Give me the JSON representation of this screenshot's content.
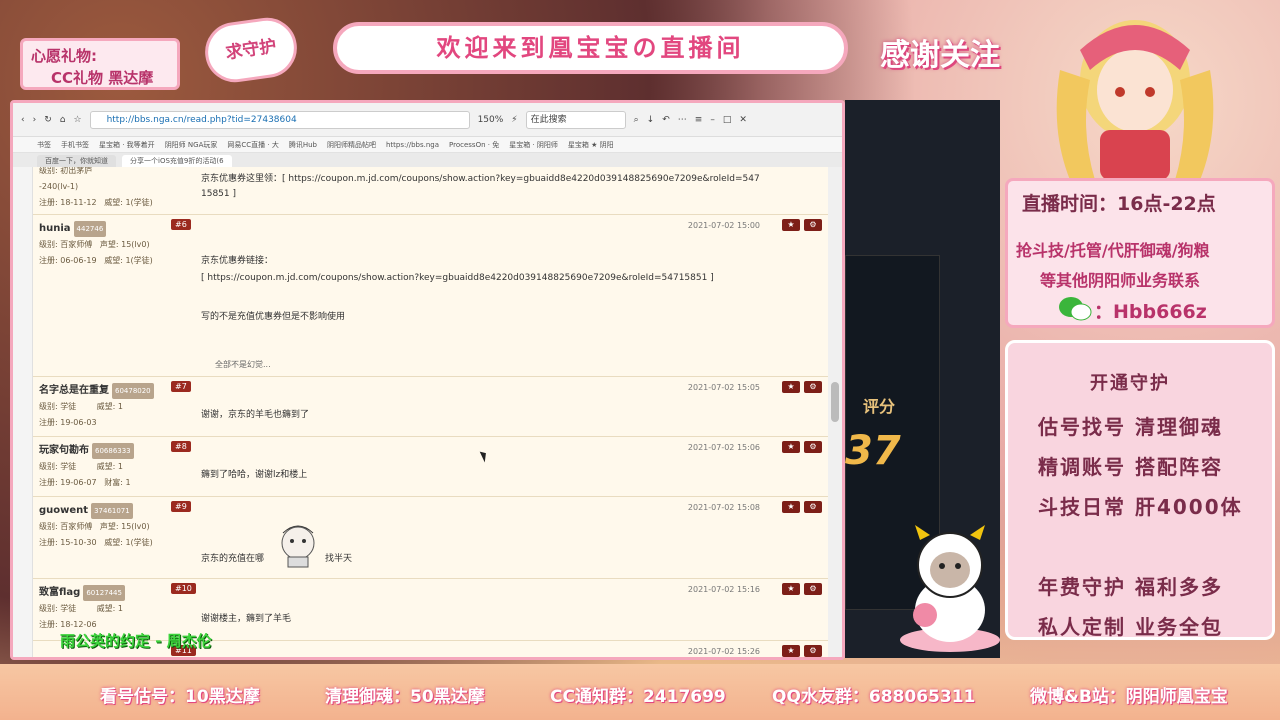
{
  "overlay": {
    "wish_title": "心愿礼物:",
    "wish_item": "CC礼物 黑达摩",
    "guard_badge": "求守护",
    "welcome": "欢迎来到凰宝宝の直播间",
    "thanks": "感谢关注",
    "live_time": "直播时间：16点-22点",
    "services_line1": "抢斗技/托管/代肝御魂/狗粮",
    "services_line2": "等其他阴阳师业务联系",
    "wechat_id": "：Hbb666z",
    "open_guard": "开通守护",
    "offers": [
      "估号找号  清理御魂",
      "精调账号  搭配阵容",
      "斗技日常  肝4000体",
      "年费守护  福利多多",
      "私人定制  业务全包"
    ],
    "bottom_items": [
      "看号估号：10黑达摩",
      "清理御魂：50黑达摩",
      "CC通知群：2417699",
      "QQ水友群：688065311",
      "微博&B站：阴阳师凰宝宝"
    ],
    "song": "雨公英的约定 - 周杰伦",
    "score_label": "评分",
    "score_value": "37"
  },
  "browser": {
    "url": "http://bbs.nga.cn/read.php?tid=27438604",
    "zoom": "150%",
    "search_placeholder": "在此搜索",
    "bookmarks": [
      "书签",
      "手机书签",
      "星宝箱 · 我等着开",
      "阴阳师 NGA玩家",
      "网易CC直播 · 大",
      "腾讯Hub",
      "阴阳师精品帖吧",
      "https://bbs.nga",
      "ProcessOn · 免",
      "星宝箱 · 阴阳师",
      "星宝箱 ★ 阴阳"
    ],
    "tabs": [
      "百度一下，你就知道",
      "分享一个iOS充值9折的活动(6"
    ],
    "posts": [
      {
        "user": "",
        "uid": "",
        "floor": "",
        "level": "级别: 初出茅庐",
        "rep": "-240(lv-1)",
        "reg": "注册: 18-11-12",
        "wei": "威望: 1(学徒)",
        "date": "",
        "text1": "京东优惠券这里领：[ https://coupon.m.jd.com/coupons/show.action?key=gbuaidd8e4220d039148825690e7209e&roleId=547",
        "text2": "15851 ]"
      },
      {
        "user": "hunia",
        "uid": "442746",
        "floor": "#6",
        "level": "级别: 百家师傅",
        "rep": "声望: 15(lv0)",
        "reg": "注册: 06-06-19",
        "wei": "威望: 1(学徒)",
        "date": "2021-07-02 15:00",
        "text1": "京东优惠券链接：",
        "text2": "[ https://coupon.m.jd.com/coupons/show.action?key=gbuaidd8e4220d039148825690e7209e&roleId=54715851 ]",
        "text3": "写的不是充值优惠券但是不影响使用",
        "text4": "全部不是幻觉..."
      },
      {
        "user": "名字总是在重复",
        "uid": "60478020",
        "floor": "#7",
        "level": "级别: 学徒",
        "rep": "威望: 1",
        "reg": "注册: 19-06-03",
        "date": "2021-07-02 15:05",
        "text1": "谢谢，京东的羊毛也薅到了"
      },
      {
        "user": "玩家句勘布",
        "uid": "60686333",
        "floor": "#8",
        "level": "级别: 学徒",
        "rep": "威望: 1",
        "reg": "注册: 19-06-07",
        "wei": "财富: 1",
        "date": "2021-07-02 15:06",
        "text1": "薅到了哈哈，谢谢lz和楼上"
      },
      {
        "user": "guowent",
        "uid": "37461071",
        "floor": "#9",
        "level": "级别: 百家师傅",
        "rep": "声望: 15(lv0)",
        "reg": "注册: 15-10-30",
        "wei": "威望: 1(学徒)",
        "date": "2021-07-02 15:08",
        "text1": "京东的充值在哪",
        "text2": "找半天"
      },
      {
        "user": "致富flag",
        "uid": "60127445",
        "floor": "#10",
        "level": "级别: 学徒",
        "rep": "威望: 1",
        "reg": "注册: 18-12-06",
        "date": "2021-07-02 15:16",
        "text1": "谢谢楼主，薅到了羊毛"
      },
      {
        "user": "",
        "uid": "",
        "floor": "#11",
        "date": "2021-07-02 15:26"
      }
    ]
  },
  "colors": {
    "accent_pink": "#f5a8bd",
    "brand_red": "#9b2a1f"
  }
}
